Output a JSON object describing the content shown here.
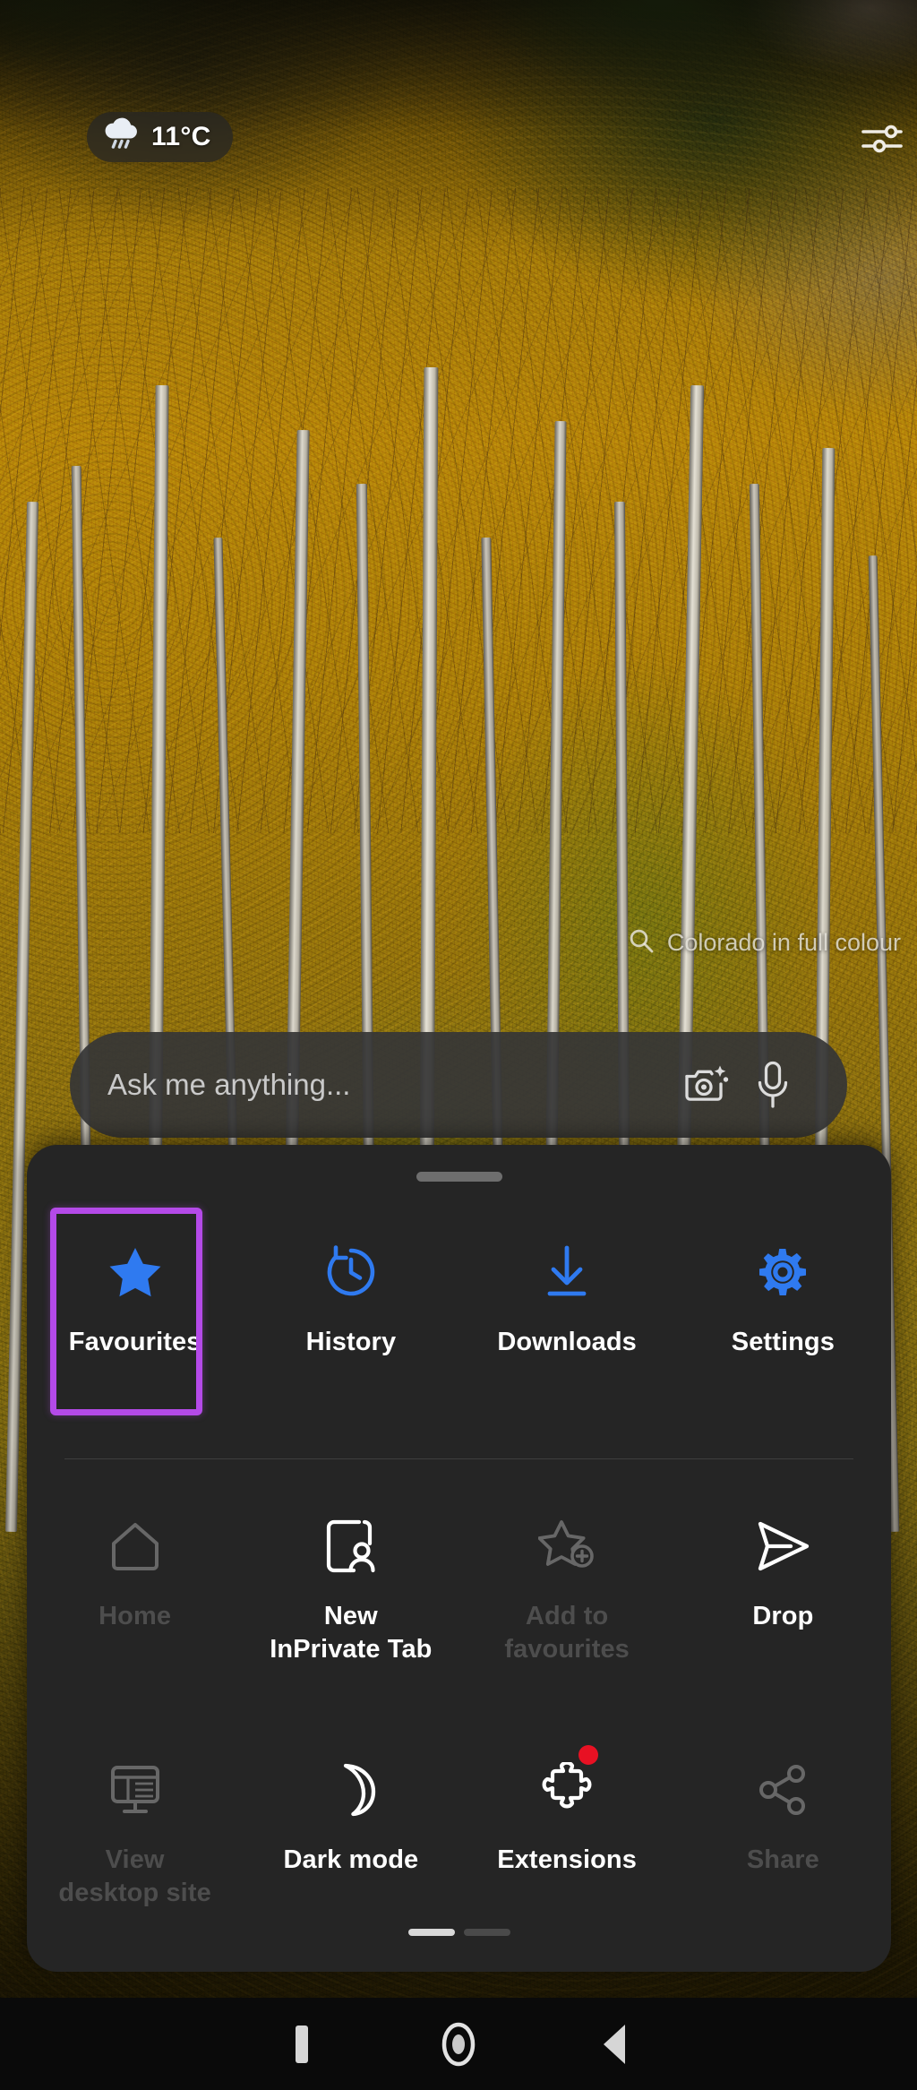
{
  "wallpaper": {
    "description": "autumn aspen grove with golden foliage and white trunks",
    "caption": "Colorado in full colour",
    "caption_icon": "search-icon"
  },
  "weather": {
    "icon": "rain-cloud-icon",
    "temperature": "11°C"
  },
  "topbar": {
    "tune_icon": "sliders-tune-icon"
  },
  "search": {
    "placeholder": "Ask me anything...",
    "camera_icon": "camera-sparkle-icon",
    "mic_icon": "microphone-icon"
  },
  "menu": {
    "drag_handle": "drag-handle",
    "highlight_color": "#b44ae8",
    "badge_color": "#e81123",
    "accent_color": "#2f7af0",
    "primary_row": [
      {
        "label": "Favourites",
        "icon": "star-filled-icon",
        "highlighted": true,
        "disabled": false
      },
      {
        "label": "History",
        "icon": "history-clock-icon",
        "highlighted": false,
        "disabled": false
      },
      {
        "label": "Downloads",
        "icon": "download-arrow-icon",
        "highlighted": false,
        "disabled": false
      },
      {
        "label": "Settings",
        "icon": "gear-icon",
        "highlighted": false,
        "disabled": false
      }
    ],
    "row_two": [
      {
        "label": "Home",
        "icon": "home-icon",
        "disabled": true,
        "badge": false
      },
      {
        "label": "New\nInPrivate Tab",
        "icon": "inprivate-tab-icon",
        "disabled": false,
        "badge": false
      },
      {
        "label": "Add to\nfavourites",
        "icon": "star-plus-icon",
        "disabled": true,
        "badge": false
      },
      {
        "label": "Drop",
        "icon": "send-paper-plane-icon",
        "disabled": false,
        "badge": false
      }
    ],
    "row_three": [
      {
        "label": "View\ndesktop site",
        "icon": "desktop-monitor-icon",
        "disabled": true,
        "badge": false
      },
      {
        "label": "Dark mode",
        "icon": "moon-icon",
        "disabled": false,
        "badge": false
      },
      {
        "label": "Extensions",
        "icon": "puzzle-piece-icon",
        "disabled": false,
        "badge": true
      },
      {
        "label": "Share",
        "icon": "share-nodes-icon",
        "disabled": true,
        "badge": false
      }
    ],
    "page_indicator": {
      "total": 2,
      "active": 1
    }
  },
  "navbar": {
    "recents_label": "recents-icon",
    "home_label": "home-circle-icon",
    "back_label": "back-triangle-icon"
  }
}
